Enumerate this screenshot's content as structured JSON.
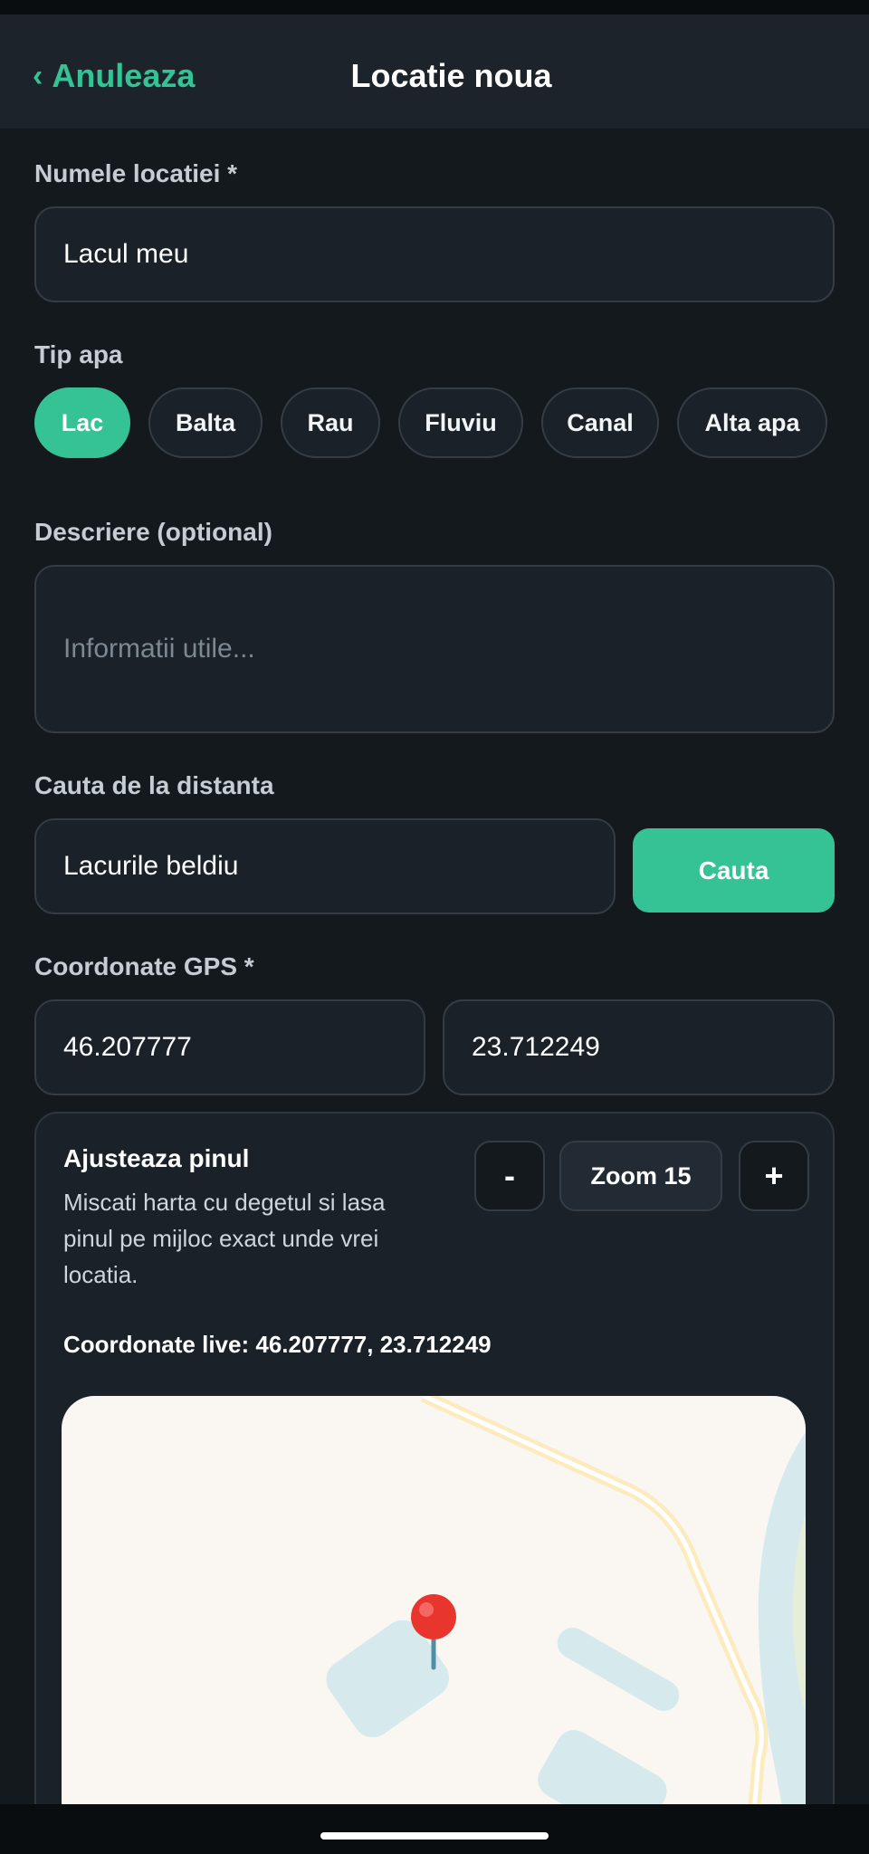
{
  "header": {
    "back_label": "Anuleaza",
    "title": "Locatie noua"
  },
  "name_field": {
    "label": "Numele locatiei *",
    "value": "Lacul meu"
  },
  "water_type": {
    "label": "Tip apa",
    "options": [
      "Lac",
      "Balta",
      "Rau",
      "Fluviu",
      "Canal",
      "Alta apa"
    ],
    "selected": "Lac"
  },
  "description": {
    "label": "Descriere (optional)",
    "placeholder": "Informatii utile..."
  },
  "remote_search": {
    "label": "Cauta de la distanta",
    "value": "Lacurile beldiu",
    "button_label": "Cauta"
  },
  "gps": {
    "label": "Coordonate GPS *",
    "latitude": "46.207777",
    "longitude": "23.712249"
  },
  "pin_card": {
    "title": "Ajusteaza pinul",
    "description": "Miscati harta cu degetul si lasa pinul pe mijloc exact unde vrei locatia.",
    "live_coords": "Coordonate live: 46.207777, 23.712249",
    "zoom_minus": "-",
    "zoom_label": "Zoom 15",
    "zoom_plus": "+"
  },
  "colors": {
    "accent": "#35c295",
    "background": "#14191e",
    "surface": "#1a2128"
  },
  "icons": {
    "back": "chevron-left-icon",
    "pin": "map-pin-icon"
  }
}
